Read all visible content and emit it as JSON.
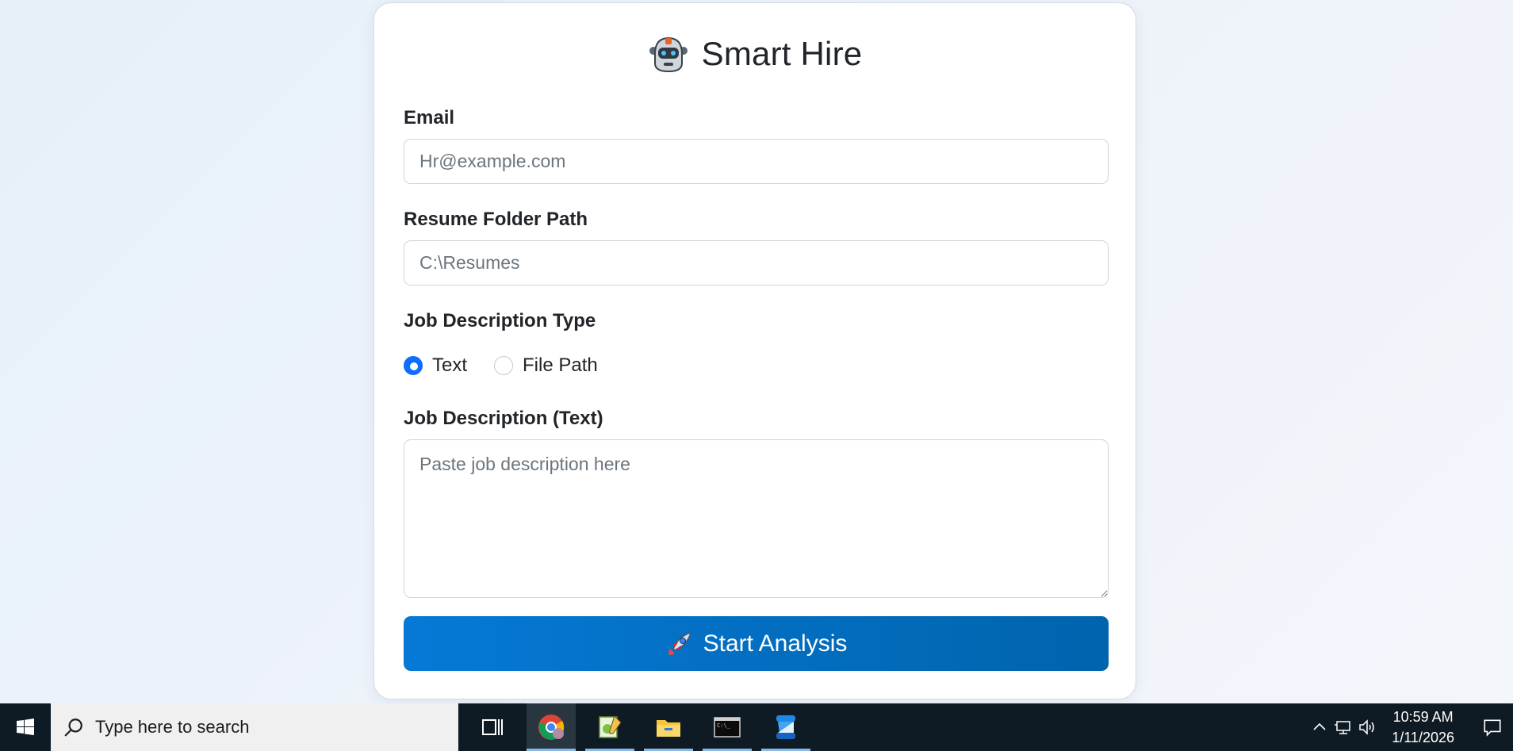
{
  "app": {
    "title": "Smart Hire"
  },
  "form": {
    "email_label": "Email",
    "email_placeholder": "Hr@example.com",
    "email_value": "",
    "resume_label": "Resume Folder Path",
    "resume_placeholder": "C:\\Resumes",
    "resume_value": "",
    "jd_type_label": "Job Description Type",
    "jd_type_options": [
      {
        "label": "Text",
        "checked": true
      },
      {
        "label": "File Path",
        "checked": false
      }
    ],
    "jd_text_label": "Job Description (Text)",
    "jd_text_placeholder": "Paste job description here",
    "jd_text_value": "",
    "submit_label": "Start Analysis"
  },
  "taskbar": {
    "search_placeholder": "Type here to search",
    "apps": [
      {
        "name": "task-view-icon"
      },
      {
        "name": "chrome-icon",
        "active": true
      },
      {
        "name": "notepad-plus-icon"
      },
      {
        "name": "file-explorer-icon"
      },
      {
        "name": "terminal-icon"
      },
      {
        "name": "blue-app-icon"
      }
    ],
    "time": "10:59 AM",
    "date": "1/11/2026"
  },
  "colors": {
    "accent": "#0d6efd",
    "button_start": "#0679d6",
    "button_end": "#0064ad",
    "taskbar_bg": "#0f1b24"
  }
}
